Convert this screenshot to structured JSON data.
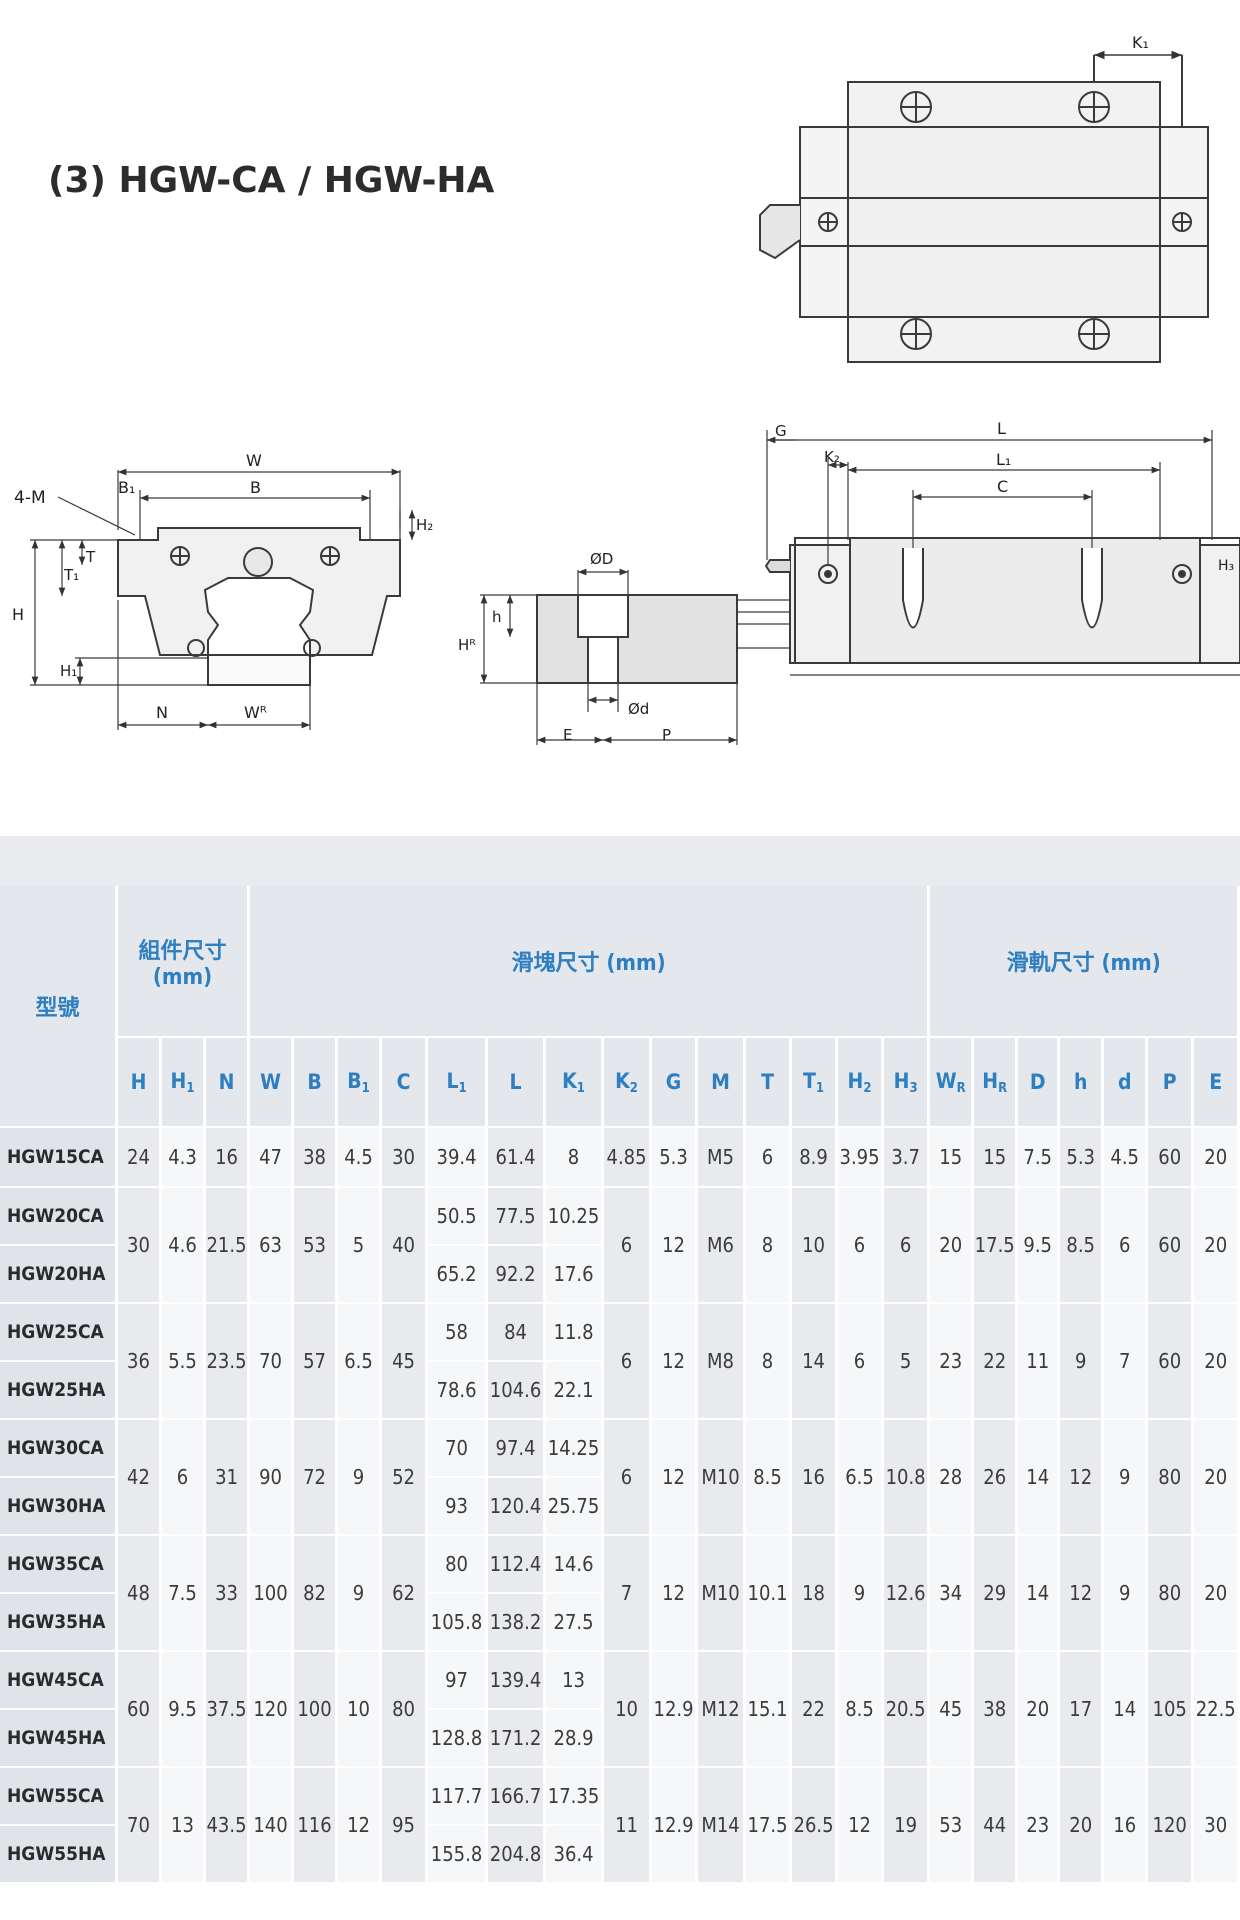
{
  "section_title": "(3) HGW-CA / HGW-HA",
  "drawing_labels": {
    "k1": "K₁",
    "w": "W",
    "b": "B",
    "b1": "B₁",
    "four_m": "4-M",
    "t": "T",
    "t1": "T₁",
    "h": "H",
    "h1": "H₁",
    "h2": "H₂",
    "n": "N",
    "wr": "Wᴿ",
    "phi_D": "ØD",
    "phi_d": "Ød",
    "hr": "Hᴿ",
    "h_small": "h",
    "e": "E",
    "p": "P",
    "g": "G",
    "k2": "K₂",
    "l": "L",
    "l1": "L₁",
    "c": "C",
    "h3": "H₃"
  },
  "table": {
    "model_header": "型號",
    "group_headers": {
      "assembly": "組件尺寸\n(mm)",
      "block": "滑塊尺寸 (mm)",
      "rail": "滑軌尺寸 (mm)"
    },
    "symbols": [
      {
        "t": "H",
        "s": ""
      },
      {
        "t": "H",
        "s": "1"
      },
      {
        "t": "N",
        "s": ""
      },
      {
        "t": "W",
        "s": ""
      },
      {
        "t": "B",
        "s": ""
      },
      {
        "t": "B",
        "s": "1"
      },
      {
        "t": "C",
        "s": ""
      },
      {
        "t": "L",
        "s": "1"
      },
      {
        "t": "L",
        "s": ""
      },
      {
        "t": "K",
        "s": "1"
      },
      {
        "t": "K",
        "s": "2"
      },
      {
        "t": "G",
        "s": ""
      },
      {
        "t": "M",
        "s": ""
      },
      {
        "t": "T",
        "s": ""
      },
      {
        "t": "T",
        "s": "1"
      },
      {
        "t": "H",
        "s": "2"
      },
      {
        "t": "H",
        "s": "3"
      },
      {
        "t": "W",
        "s": "R"
      },
      {
        "t": "H",
        "s": "R"
      },
      {
        "t": "D",
        "s": ""
      },
      {
        "t": "h",
        "s": ""
      },
      {
        "t": "d",
        "s": ""
      },
      {
        "t": "P",
        "s": ""
      },
      {
        "t": "E",
        "s": ""
      }
    ],
    "groups": [
      {
        "models": [
          "HGW15CA"
        ],
        "H": "24",
        "H1": "4.3",
        "N": "16",
        "W": "47",
        "B": "38",
        "B1": "4.5",
        "C": "30",
        "L1": [
          "39.4"
        ],
        "L": [
          "61.4"
        ],
        "K1": [
          "8"
        ],
        "K2": "4.85",
        "G": "5.3",
        "M": "M5",
        "T": "6",
        "T1": "8.9",
        "H2": "3.95",
        "H3": "3.7",
        "WR": "15",
        "HR": "15",
        "D": "7.5",
        "h": "5.3",
        "d": "4.5",
        "P": "60",
        "E": "20"
      },
      {
        "models": [
          "HGW20CA",
          "HGW20HA"
        ],
        "H": "30",
        "H1": "4.6",
        "N": "21.5",
        "W": "63",
        "B": "53",
        "B1": "5",
        "C": "40",
        "L1": [
          "50.5",
          "65.2"
        ],
        "L": [
          "77.5",
          "92.2"
        ],
        "K1": [
          "10.25",
          "17.6"
        ],
        "K2": "6",
        "G": "12",
        "M": "M6",
        "T": "8",
        "T1": "10",
        "H2": "6",
        "H3": "6",
        "WR": "20",
        "HR": "17.5",
        "D": "9.5",
        "h": "8.5",
        "d": "6",
        "P": "60",
        "E": "20"
      },
      {
        "models": [
          "HGW25CA",
          "HGW25HA"
        ],
        "H": "36",
        "H1": "5.5",
        "N": "23.5",
        "W": "70",
        "B": "57",
        "B1": "6.5",
        "C": "45",
        "L1": [
          "58",
          "78.6"
        ],
        "L": [
          "84",
          "104.6"
        ],
        "K1": [
          "11.8",
          "22.1"
        ],
        "K2": "6",
        "G": "12",
        "M": "M8",
        "T": "8",
        "T1": "14",
        "H2": "6",
        "H3": "5",
        "WR": "23",
        "HR": "22",
        "D": "11",
        "h": "9",
        "d": "7",
        "P": "60",
        "E": "20"
      },
      {
        "models": [
          "HGW30CA",
          "HGW30HA"
        ],
        "H": "42",
        "H1": "6",
        "N": "31",
        "W": "90",
        "B": "72",
        "B1": "9",
        "C": "52",
        "L1": [
          "70",
          "93"
        ],
        "L": [
          "97.4",
          "120.4"
        ],
        "K1": [
          "14.25",
          "25.75"
        ],
        "K2": "6",
        "G": "12",
        "M": "M10",
        "T": "8.5",
        "T1": "16",
        "H2": "6.5",
        "H3": "10.8",
        "WR": "28",
        "HR": "26",
        "D": "14",
        "h": "12",
        "d": "9",
        "P": "80",
        "E": "20"
      },
      {
        "models": [
          "HGW35CA",
          "HGW35HA"
        ],
        "H": "48",
        "H1": "7.5",
        "N": "33",
        "W": "100",
        "B": "82",
        "B1": "9",
        "C": "62",
        "L1": [
          "80",
          "105.8"
        ],
        "L": [
          "112.4",
          "138.2"
        ],
        "K1": [
          "14.6",
          "27.5"
        ],
        "K2": "7",
        "G": "12",
        "M": "M10",
        "T": "10.1",
        "T1": "18",
        "H2": "9",
        "H3": "12.6",
        "WR": "34",
        "HR": "29",
        "D": "14",
        "h": "12",
        "d": "9",
        "P": "80",
        "E": "20"
      },
      {
        "models": [
          "HGW45CA",
          "HGW45HA"
        ],
        "H": "60",
        "H1": "9.5",
        "N": "37.5",
        "W": "120",
        "B": "100",
        "B1": "10",
        "C": "80",
        "L1": [
          "97",
          "128.8"
        ],
        "L": [
          "139.4",
          "171.2"
        ],
        "K1": [
          "13",
          "28.9"
        ],
        "K2": "10",
        "G": "12.9",
        "M": "M12",
        "T": "15.1",
        "T1": "22",
        "H2": "8.5",
        "H3": "20.5",
        "WR": "45",
        "HR": "38",
        "D": "20",
        "h": "17",
        "d": "14",
        "P": "105",
        "E": "22.5"
      },
      {
        "models": [
          "HGW55CA",
          "HGW55HA"
        ],
        "H": "70",
        "H1": "13",
        "N": "43.5",
        "W": "140",
        "B": "116",
        "B1": "12",
        "C": "95",
        "L1": [
          "117.7",
          "155.8"
        ],
        "L": [
          "166.7",
          "204.8"
        ],
        "K1": [
          "17.35",
          "36.4"
        ],
        "K2": "11",
        "G": "12.9",
        "M": "M14",
        "T": "17.5",
        "T1": "26.5",
        "H2": "12",
        "H3": "19",
        "WR": "53",
        "HR": "44",
        "D": "23",
        "h": "20",
        "d": "16",
        "P": "120",
        "E": "30"
      }
    ]
  }
}
